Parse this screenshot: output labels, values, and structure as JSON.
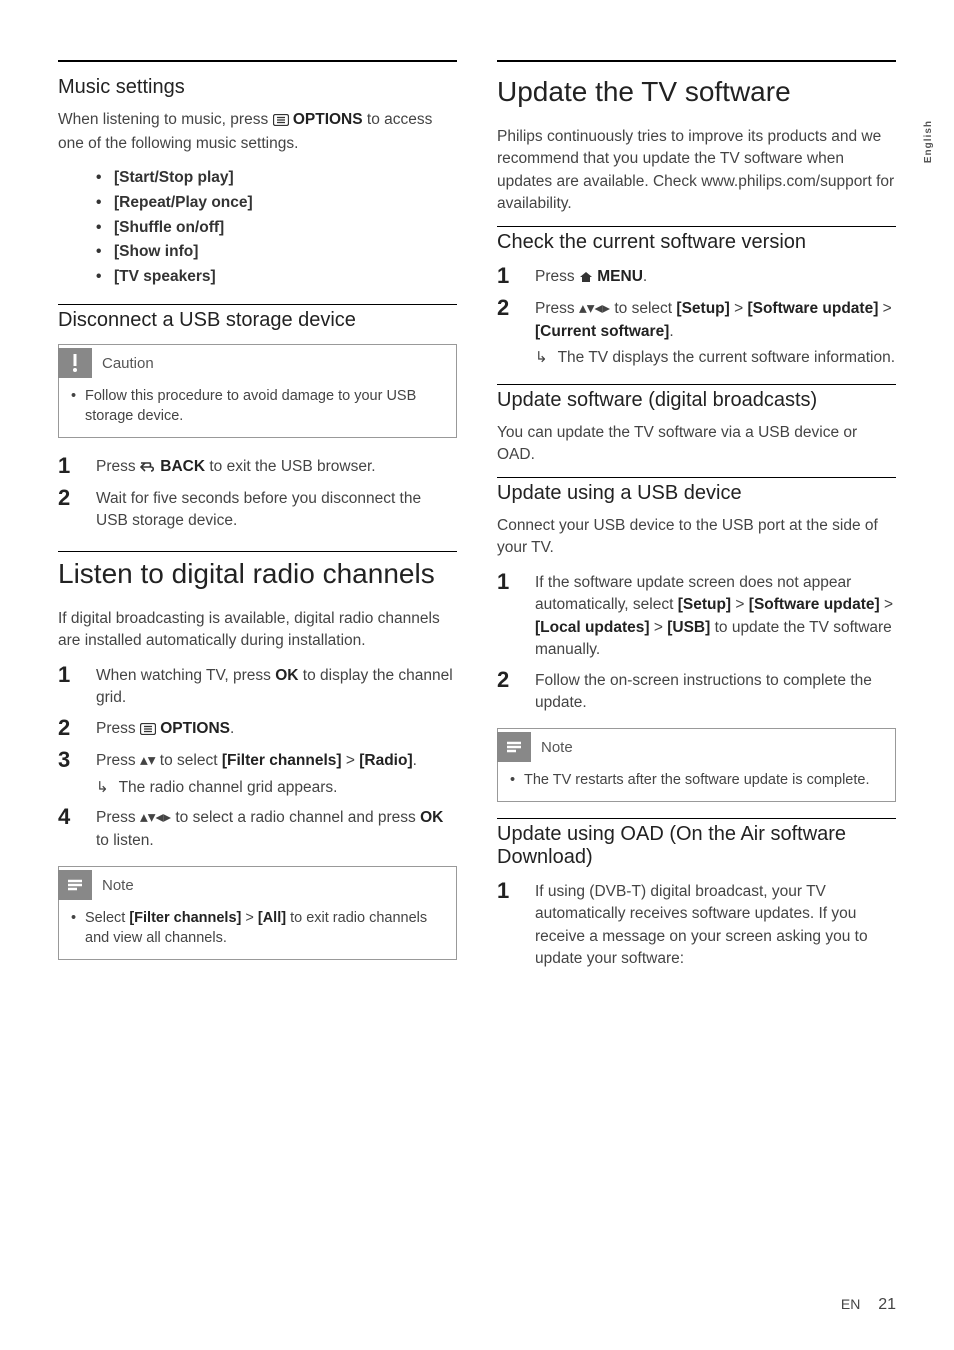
{
  "lang_tab": "English",
  "footer": {
    "lang": "EN",
    "page": "21"
  },
  "left": {
    "sec1": {
      "title": "Music settings",
      "intro_a": "When listening to music, press ",
      "intro_b_bold": "OPTIONS",
      "intro_c": " to access one of the following music settings.",
      "items": [
        "[Start/Stop play]",
        "[Repeat/Play once]",
        "[Shuffle on/off]",
        "[Show info]",
        "[TV speakers]"
      ]
    },
    "sec2": {
      "title": "Disconnect a USB storage device",
      "caution_label": "Caution",
      "caution_text": "Follow this procedure to avoid damage to your USB storage device.",
      "step1_a": "Press ",
      "step1_b_bold": "BACK",
      "step1_c": " to exit the USB browser.",
      "step2": "Wait for five seconds before you disconnect the USB storage device."
    },
    "sec3": {
      "title": "Listen to digital radio channels",
      "intro": "If digital broadcasting is available, digital radio channels are installed automatically during installation.",
      "s1_a": "When watching TV, press ",
      "s1_b_bold": "OK",
      "s1_c": " to display the channel grid.",
      "s2_a": "Press ",
      "s2_b_bold": "OPTIONS",
      "s2_c": ".",
      "s3_a": "Press ",
      "s3_b": " to select ",
      "s3_c_bold": "[Filter channels]",
      "s3_d": " > ",
      "s3_e_bold": "[Radio]",
      "s3_f": ".",
      "s3_sub": "The radio channel grid appears.",
      "s4_a": "Press ",
      "s4_b": " to select a radio channel and press ",
      "s4_c_bold": "OK",
      "s4_d": " to listen.",
      "note_label": "Note",
      "note_a": "Select ",
      "note_b_bold": "[Filter channels]",
      "note_c": " > ",
      "note_d_bold": "[All]",
      "note_e": " to exit radio channels and view all channels."
    }
  },
  "right": {
    "sec1": {
      "title": "Update the TV software",
      "intro": "Philips continuously tries to improve its products and we recommend that you update the TV software when updates are available. Check www.philips.com/support for availability."
    },
    "sec2": {
      "title": "Check the current software version",
      "s1_a": "Press ",
      "s1_b_bold": "MENU",
      "s1_c": ".",
      "s2_a": "Press ",
      "s2_b": " to select ",
      "s2_c_bold": "[Setup]",
      "s2_d": " > ",
      "s2_e_bold": "[Software update]",
      "s2_f": " > ",
      "s2_g_bold": "[Current software]",
      "s2_h": ".",
      "s2_sub": "The TV displays the current software information."
    },
    "sec3": {
      "title": "Update software (digital broadcasts)",
      "intro": "You can update the TV software via a USB device or OAD."
    },
    "sec4": {
      "title": "Update using a USB device",
      "intro": "Connect your USB device to the USB port at the side of your TV.",
      "s1_a": "If the software update screen does not appear automatically, select ",
      "s1_b_bold": "[Setup]",
      "s1_c": " > ",
      "s1_d_bold": "[Software update]",
      "s1_e": " > ",
      "s1_f_bold": "[Local updates]",
      "s1_g": " > ",
      "s1_h_bold": "[USB]",
      "s1_i": " to update the TV software manually.",
      "s2": "Follow the on-screen instructions to complete the update.",
      "note_label": "Note",
      "note_text": "The TV restarts after the software update is complete."
    },
    "sec5": {
      "title": "Update using OAD (On the Air software Download)",
      "s1": "If using (DVB-T) digital broadcast, your TV automatically receives software updates. If you receive a message on your screen asking you to update your software:"
    }
  }
}
